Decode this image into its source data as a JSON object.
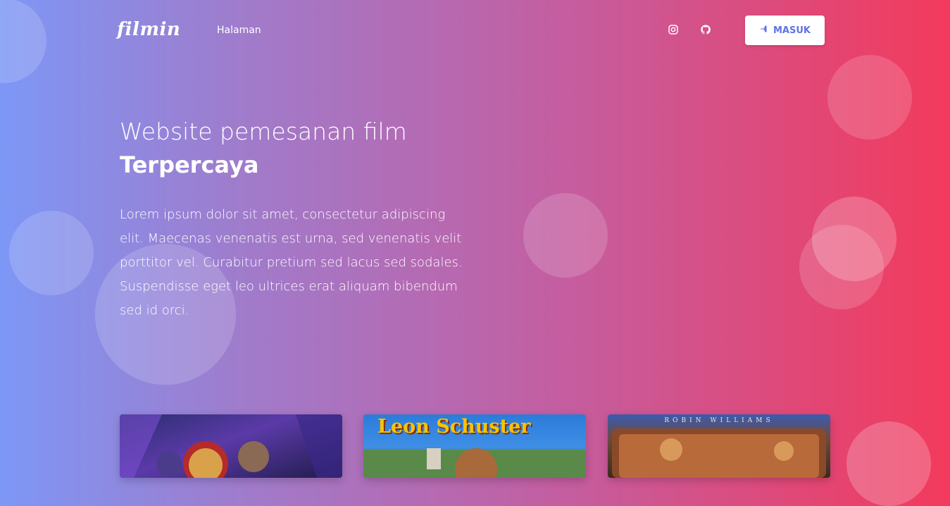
{
  "brand": {
    "logo": "filmin"
  },
  "nav": {
    "links": [
      "Halaman"
    ]
  },
  "social": {
    "instagram": "instagram-icon",
    "github": "github-icon"
  },
  "auth": {
    "login_label": "MASUK",
    "login_icon": "sign-in-icon"
  },
  "hero": {
    "title_line1": "Website pemesanan film",
    "title_line2": "Terpercaya",
    "description": "Lorem ipsum dolor sit amet, consectetur adipiscing elit. Maecenas venenatis est urna, sed venenatis velit porttitor vel. Curabitur pretium sed lacus sed sodales. Suspendisse eget leo ultrices erat aliquam bibendum sed id orci."
  },
  "movies": [
    {
      "poster_text": ""
    },
    {
      "poster_text": "Leon Schuster"
    },
    {
      "poster_text": "ROBIN WILLIAMS"
    }
  ],
  "colors": {
    "accent": "#5e72e4",
    "gradient_start": "#7d97f6",
    "gradient_end": "#f33a5c"
  }
}
